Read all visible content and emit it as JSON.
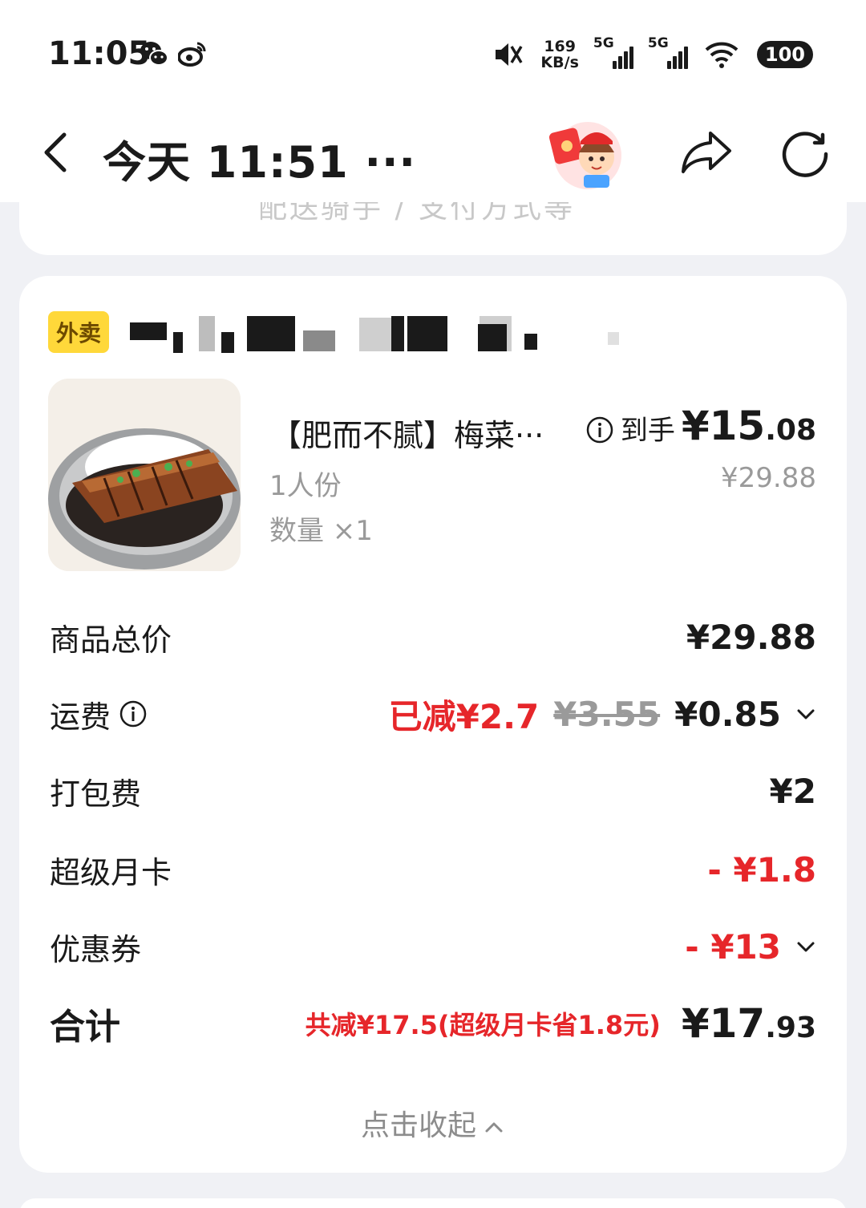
{
  "status": {
    "time": "11:05",
    "net_speed": "169",
    "net_unit": "KB/s",
    "sig1": "5G",
    "sig2": "5G",
    "battery": "100",
    "icons": [
      "wechat-icon",
      "weibo-icon",
      "mute-icon",
      "signal-icon",
      "wifi-icon",
      "battery-icon"
    ]
  },
  "nav": {
    "title": "今天 11:51 ···"
  },
  "prev_card": {
    "text": "配送骑手 / 支付方式等 ˅"
  },
  "order": {
    "tag": "外卖",
    "item": {
      "name": "【肥而不腻】梅菜···",
      "spec": "1人份",
      "qty": "数量 ×1",
      "daoshou": "到手",
      "price_symbol": "¥",
      "price_int": "15",
      "price_dec": ".08",
      "orig_price": "¥29.88"
    },
    "fees": {
      "goods_label": "商品总价",
      "goods_value": "¥29.88",
      "delivery_label": "运费",
      "delivery_discount": "已减¥2.7",
      "delivery_orig": "¥3.55",
      "delivery_value": "¥0.85",
      "packing_label": "打包费",
      "packing_value": "¥2",
      "card_label": "超级月卡",
      "card_value": "- ¥1.8",
      "coupon_label": "优惠券",
      "coupon_value": "- ¥13",
      "total_label": "合计",
      "total_save": "共减¥17.5(超级月卡省1.8元)",
      "total_symbol": "¥",
      "total_int": "17",
      "total_dec": ".93"
    },
    "collapse_label": "点击收起"
  },
  "colors": {
    "accent_red": "#e6262a",
    "tag_yellow": "#ffd83a",
    "background": "#f0f1f5"
  }
}
